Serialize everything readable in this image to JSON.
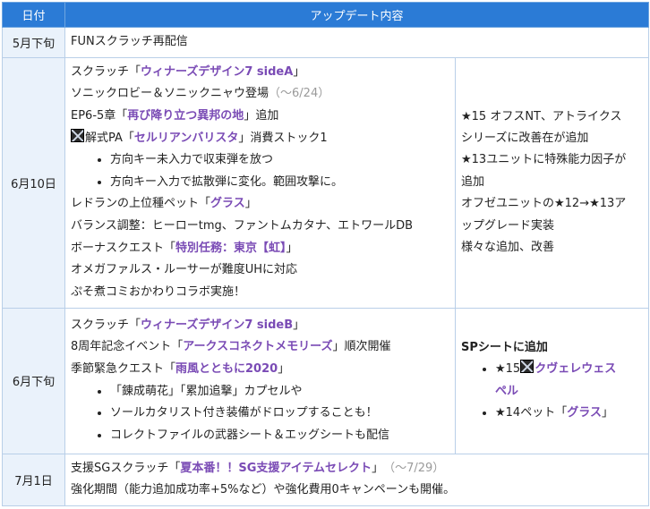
{
  "header": {
    "date": "日付",
    "content": "アップデート内容"
  },
  "rows": [
    {
      "date": "5月下旬",
      "line": "FUNスクラッチ再配信"
    },
    {
      "date": "6月10日",
      "l1_pre": "スクラッチ「",
      "l1_hl": "ウィナーズデザイン7 sideA",
      "l1_post": "」",
      "l2": "ソニックロビー＆ソニックニャウ登場",
      "l2_gray": "（～6/24）",
      "l3_pre": "EP6-5章「",
      "l3_hl": "再び降り立つ異邦の地",
      "l3_post": "」追加",
      "l4_pre": "解式PA「",
      "l4_hl": "セルリアンバリスタ",
      "l4_post": "」消費ストック1",
      "l4_icon": "weapon-icon",
      "b1": "方向キー未入力で収束弾を放つ",
      "b2": "方向キー入力で拡散弾に変化。範囲攻撃に。",
      "l5_pre": "レドランの上位種ペット「",
      "l5_hl": "グラス",
      "l5_post": "」",
      "l6": "バランス調整：ヒーローtmg、ファントムカタナ、エトワールDB",
      "l7_pre": "ボーナスクエスト「",
      "l7_hl": "特別任務：東京【虹】",
      "l7_post": "」",
      "l8": "オメガファルス・ルーサーが難度UHに対応",
      "l9": "ぷそ煮コミおかわりコラボ実施！",
      "side1": "★15 オフスNT、アトライクス",
      "side2": "シリーズに改善在が追加",
      "side3": "★13ユニットに特殊能力因子が",
      "side4": "追加",
      "side5": "オフゼユニットの★12→★13ア",
      "side6": "ップグレード実装",
      "side7": "様々な追加、改善"
    },
    {
      "date": "6月下旬",
      "l1_pre": "スクラッチ「",
      "l1_hl": "ウィナーズデザイン7 sideB",
      "l1_post": "」",
      "l2_pre": "8周年記念イベント「",
      "l2_hl": "アークスコネクトメモリーズ",
      "l2_post": "」順次開催",
      "l3_pre": "季節緊急クエスト「",
      "l3_hl": "雨風とともに2020",
      "l3_post": "」",
      "b1": "「錬成萌花」「累加追撃」カプセルや",
      "b2": "ソールカタリスト付き装備がドロップすることも！",
      "b3": "コレクトファイルの武器シート＆エッグシートも配信",
      "side_title": "SPシートに追加",
      "s1_pre": "★15",
      "s1_hl_a": "クヴェレウェス",
      "s1_hl_b": "ペル",
      "s1_icon": "weapon-icon",
      "s2_pre": "★14ペット「",
      "s2_hl": "グラス",
      "s2_post": "」"
    },
    {
      "date": "7月1日",
      "l1_pre": "支援SGスクラッチ「",
      "l1_hl": "夏本番！！SG支援アイテムセレクト",
      "l1_post": "」",
      "l1_gray": "（～7/29）",
      "l2": "強化期間（能力追加成功率+5%など）や強化費用0キャンペーンも開催。"
    }
  ]
}
